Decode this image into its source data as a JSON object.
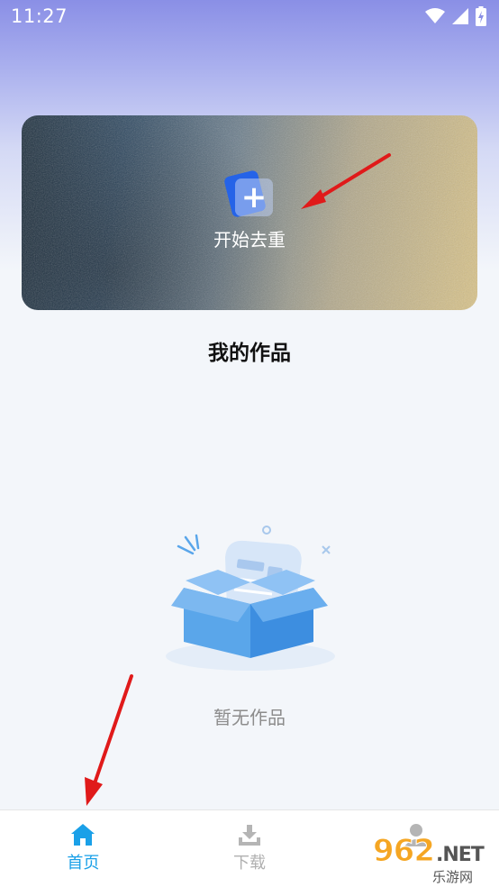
{
  "status_bar": {
    "time": "11:27"
  },
  "banner": {
    "start_label": "开始去重"
  },
  "works": {
    "title": "我的作品",
    "empty_text": "暂无作品"
  },
  "tabs": [
    {
      "label": "首页",
      "icon": "home-icon",
      "active": true
    },
    {
      "label": "下载",
      "icon": "download-icon",
      "active": false
    },
    {
      "label": "",
      "icon": "profile-icon",
      "active": false
    }
  ],
  "watermark": {
    "brand": "962",
    "domain": ".NET",
    "sub": "乐游网"
  },
  "colors": {
    "accent": "#1aa0e8",
    "start_icon_blue": "#2563e8",
    "arrow": "#e01a1a",
    "watermark": "#f5a623"
  }
}
